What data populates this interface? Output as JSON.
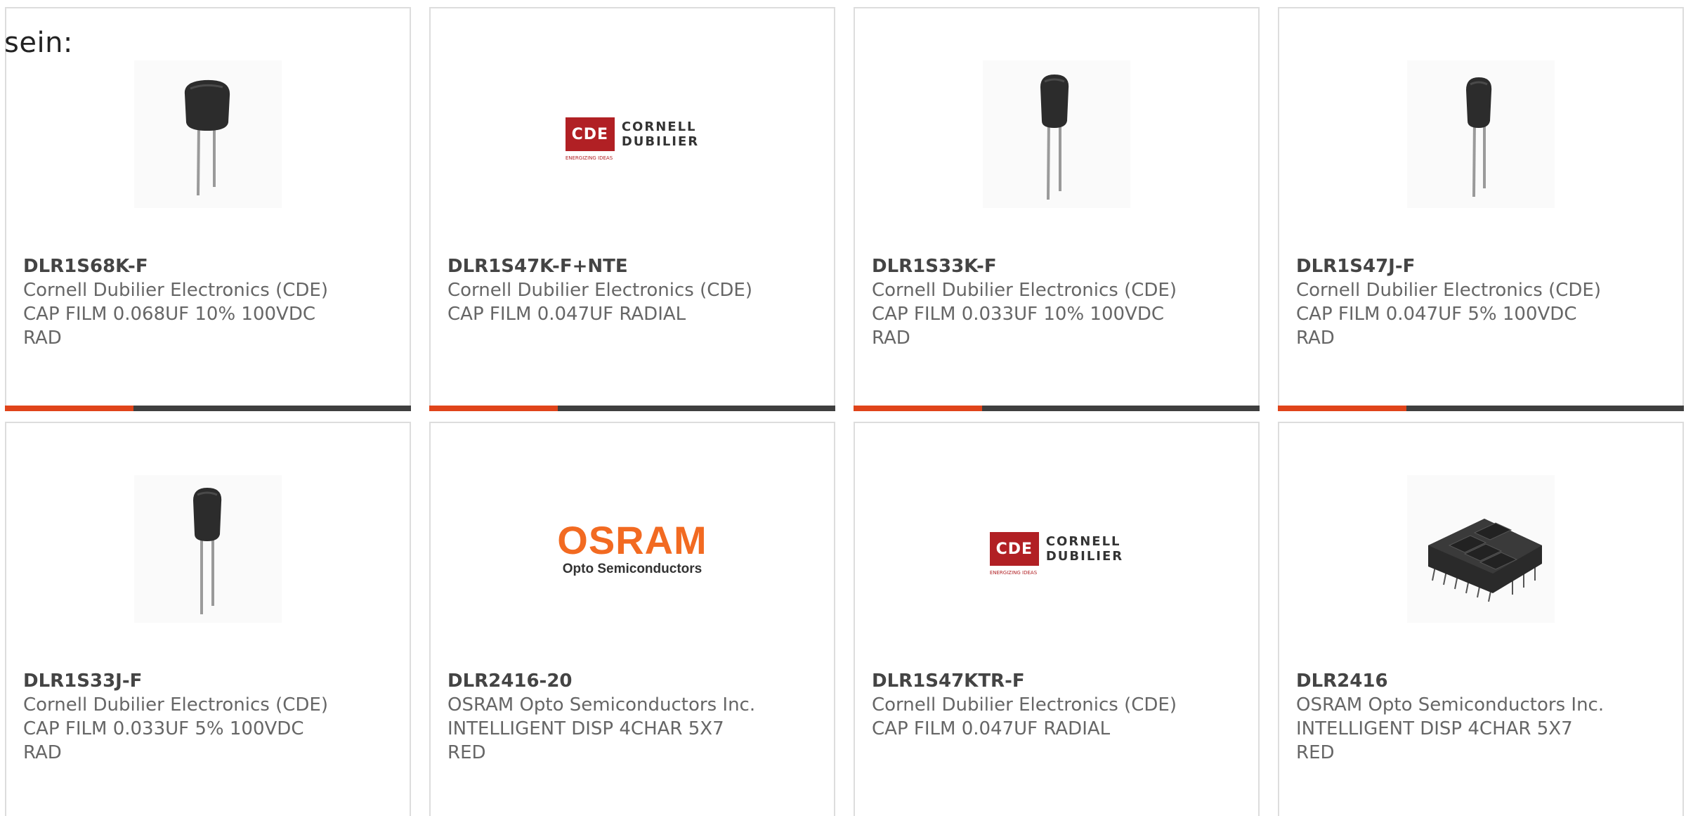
{
  "lead_text": "sein:",
  "products": [
    {
      "part_number": "DLR1S68K-F",
      "manufacturer": "Cornell Dubilier Electronics (CDE)",
      "description_line1": "CAP FILM 0.068UF 10% 100VDC",
      "description_line2": "RAD",
      "image": "film-capacitor-photo"
    },
    {
      "part_number": "DLR1S47K-F+NTE",
      "manufacturer": "Cornell Dubilier Electronics (CDE)",
      "description_line1": "CAP FILM 0.047UF RADIAL",
      "description_line2": "",
      "image": "cde-logo",
      "logo": {
        "badge": "CDE",
        "line1": "CORNELL",
        "line2": "DUBILIER",
        "tagline": "ENERGIZING IDEAS"
      }
    },
    {
      "part_number": "DLR1S33K-F",
      "manufacturer": "Cornell Dubilier Electronics (CDE)",
      "description_line1": "CAP FILM 0.033UF 10% 100VDC",
      "description_line2": "RAD",
      "image": "film-capacitor-photo"
    },
    {
      "part_number": "DLR1S47J-F",
      "manufacturer": "Cornell Dubilier Electronics (CDE)",
      "description_line1": "CAP FILM 0.047UF 5% 100VDC",
      "description_line2": "RAD",
      "image": "film-capacitor-photo"
    },
    {
      "part_number": "DLR1S33J-F",
      "manufacturer": "Cornell Dubilier Electronics (CDE)",
      "description_line1": "CAP FILM 0.033UF 5% 100VDC",
      "description_line2": "RAD",
      "image": "film-capacitor-photo"
    },
    {
      "part_number": "DLR2416-20",
      "manufacturer": "OSRAM Opto Semiconductors Inc.",
      "description_line1": "INTELLIGENT DISP 4CHAR 5X7",
      "description_line2": "RED",
      "image": "osram-logo",
      "logo": {
        "word": "OSRAM",
        "sub": "Opto Semiconductors"
      }
    },
    {
      "part_number": "DLR1S47KTR-F",
      "manufacturer": "Cornell Dubilier Electronics (CDE)",
      "description_line1": "CAP FILM 0.047UF RADIAL",
      "description_line2": "",
      "image": "cde-logo",
      "logo": {
        "badge": "CDE",
        "line1": "CORNELL",
        "line2": "DUBILIER",
        "tagline": "ENERGIZING IDEAS"
      }
    },
    {
      "part_number": "DLR2416",
      "manufacturer": "OSRAM Opto Semiconductors Inc.",
      "description_line1": "INTELLIGENT DISP 4CHAR 5X7",
      "description_line2": "RED",
      "image": "led-display-photo"
    }
  ],
  "colors": {
    "accent": "#e0441a",
    "bar": "#3f3f3f",
    "border": "#dddddd",
    "part_number": "#444444",
    "body_text": "#666666"
  }
}
